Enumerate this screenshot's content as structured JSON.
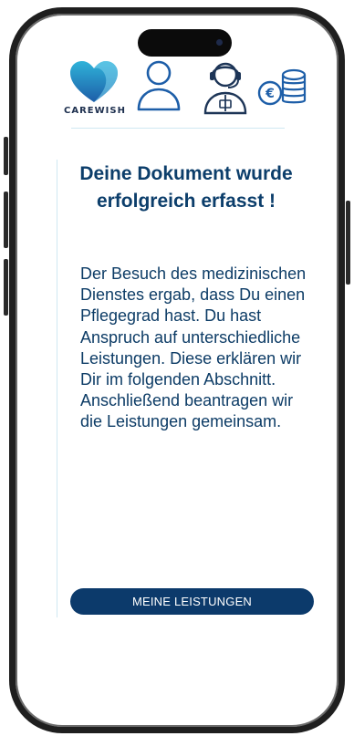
{
  "brand": {
    "logo_text": "CAREWISH"
  },
  "header": {
    "icons": [
      "person-outline-icon",
      "support-agent-icon",
      "euro-coins-icon"
    ]
  },
  "content": {
    "title": "Deine Dokument wurde erfolgreich erfasst !",
    "body": "Der Besuch des medizinischen Dienstes ergab, dass Du einen Pflegegrad hast. Du hast Anspruch auf unterschiedliche Leistungen. Diese erklären wir Dir im folgenden Abschnitt. Anschließend beantragen wir die Leistungen gemeinsam.",
    "cta_label": "MEINE LEISTUNGEN"
  },
  "colors": {
    "primary": "#0c3a6b",
    "heading": "#0c3e6b",
    "logo_gradient_top": "#2fb3d9",
    "logo_gradient_bottom": "#1d5ea8",
    "rule": "#cfe7f2"
  }
}
